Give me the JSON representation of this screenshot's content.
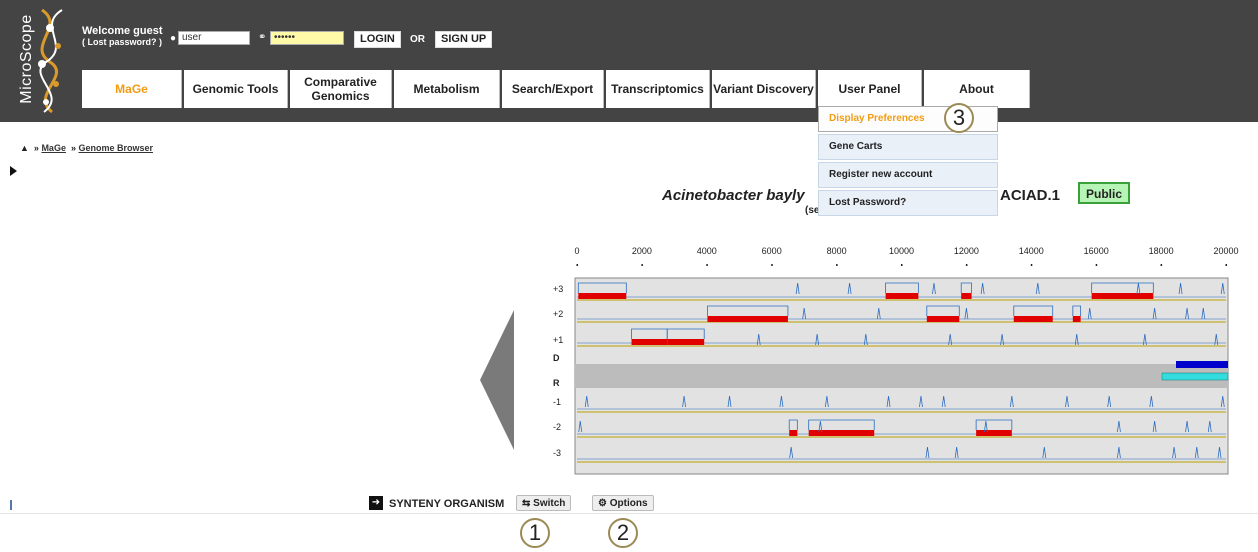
{
  "header": {
    "logo_text": "MicroScope",
    "welcome": "Welcome guest",
    "lost_password_link": "( Lost password? )",
    "username_value": "user",
    "password_value": "••••••",
    "login_label": "LOGIN",
    "or_label": "OR",
    "signup_label": "SIGN UP"
  },
  "nav": {
    "items": [
      {
        "label": "MaGe",
        "active": true
      },
      {
        "label": "Genomic Tools"
      },
      {
        "label": "Comparative Genomics"
      },
      {
        "label": "Metabolism"
      },
      {
        "label": "Search/Export"
      },
      {
        "label": "Transcriptomics"
      },
      {
        "label": "Variant Discovery"
      },
      {
        "label": "User Panel"
      },
      {
        "label": "About"
      }
    ]
  },
  "user_panel_menu": {
    "items": [
      {
        "label": "Display Preferences",
        "selected": true
      },
      {
        "label": "Gene Carts"
      },
      {
        "label": "Register new account"
      },
      {
        "label": "Lost Password?"
      }
    ]
  },
  "breadcrumb": {
    "home_icon": "home-icon",
    "items": [
      "MaGe",
      "Genome Browser"
    ]
  },
  "genome": {
    "title_species": "Acinetobacter bayly",
    "title_replicon": "ACIAD.1",
    "subtitle": "(se",
    "badge": "Public"
  },
  "browser": {
    "ruler_labels": [
      "0",
      "2000",
      "4000",
      "6000",
      "8000",
      "10000",
      "12000",
      "14000",
      "16000",
      "18000",
      "20000"
    ],
    "frame_labels": [
      "+3",
      "+2",
      "+1",
      "D",
      "R",
      "-1",
      "-2",
      "-3"
    ],
    "colors": {
      "gene": "#e00000",
      "signal": "#2a6cc0",
      "direct": "#0000cc",
      "reverse": "#33dddd",
      "track_line": "#c8b84a"
    },
    "genes": {
      "plus3": [
        [
          40,
          1520
        ],
        [
          9510,
          10520
        ],
        [
          11840,
          12160
        ],
        [
          15860,
          17760
        ]
      ],
      "plus2": [
        [
          4020,
          6500
        ],
        [
          10780,
          11780
        ],
        [
          13460,
          14660
        ],
        [
          15280,
          15520
        ]
      ],
      "plus1": [
        [
          1680,
          2780
        ],
        [
          2780,
          3920
        ]
      ],
      "minus2": [
        [
          6540,
          6790
        ],
        [
          7140,
          9160
        ],
        [
          12300,
          13400
        ]
      ]
    }
  },
  "synteny": {
    "label": "SYNTENY ORGANISM",
    "switch_label": "Switch",
    "options_label": "Options"
  },
  "annotations": [
    "1",
    "2",
    "3"
  ]
}
